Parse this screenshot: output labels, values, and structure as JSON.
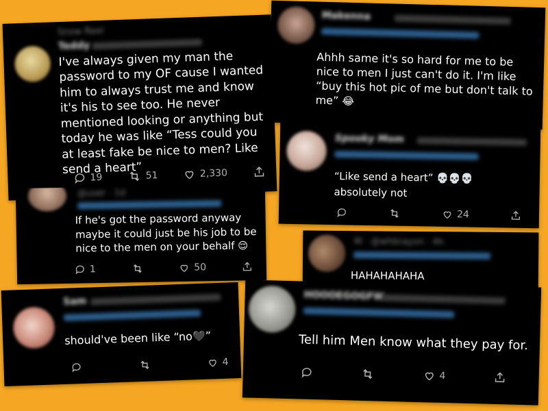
{
  "accent": "#f5a623",
  "card_bg": "#000000",
  "text_color": "#ffffff",
  "meta_color": "#b0b0b0",
  "tweets": [
    {
      "author": "Teddy",
      "text": "I've always given my man the password to my OF cause I wanted him to always trust me and know it's his to see too. He never mentioned looking or anything but today he was like “Tess could you at least fake be nice to men? Like send a heart”",
      "replies": "19",
      "retweets": "51",
      "likes": "2,330"
    },
    {
      "text_main": "Ahhh same it's so hard for me to be nice to men I just can't do it. I'm like “buy this hot pic of me but don't talk to me”",
      "emoji": "😂"
    },
    {
      "text_main": "If he's got the password anyway maybe it could just be his job to be nice to the men on your behalf",
      "emoji": "😌",
      "replies": "1",
      "likes": "50"
    },
    {
      "text_main": "“Like send a heart”",
      "emoji": "💀💀💀",
      "text_tail": "absolutely not",
      "likes": "24"
    },
    {
      "text": "HAHAHAHAHA"
    },
    {
      "text_main": "should've been like “no",
      "emoji": "🖤",
      "text_tail": "”",
      "likes": "4"
    },
    {
      "text": "Tell him Men know what they pay for.",
      "likes": "4"
    }
  ]
}
